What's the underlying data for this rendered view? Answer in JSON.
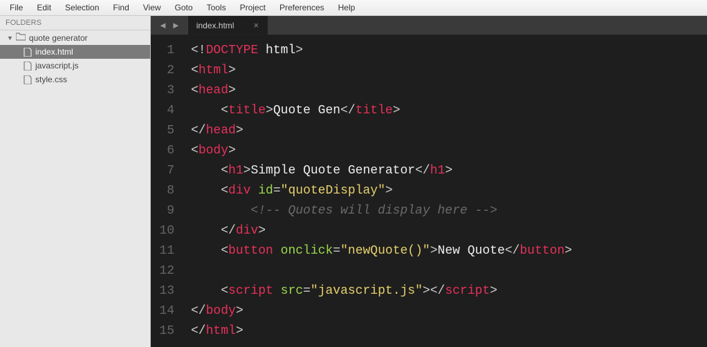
{
  "menubar": [
    "File",
    "Edit",
    "Selection",
    "Find",
    "View",
    "Goto",
    "Tools",
    "Project",
    "Preferences",
    "Help"
  ],
  "sidebar": {
    "header": "FOLDERS",
    "folder": "quote generator",
    "files": [
      {
        "name": "index.html",
        "active": true
      },
      {
        "name": "javascript.js",
        "active": false
      },
      {
        "name": "style.css",
        "active": false
      }
    ]
  },
  "tab": {
    "title": "index.html"
  },
  "code": {
    "tokens": [
      [
        {
          "t": "p",
          "v": "<!"
        },
        {
          "t": "doctype-kw",
          "v": "DOCTYPE"
        },
        {
          "t": "txt",
          "v": " html"
        },
        {
          "t": "p",
          "v": ">"
        }
      ],
      [
        {
          "t": "p",
          "v": "<"
        },
        {
          "t": "tag",
          "v": "html"
        },
        {
          "t": "p",
          "v": ">"
        }
      ],
      [
        {
          "t": "p",
          "v": "<"
        },
        {
          "t": "tag",
          "v": "head"
        },
        {
          "t": "p",
          "v": ">"
        }
      ],
      [
        {
          "t": "txt",
          "v": "    "
        },
        {
          "t": "p",
          "v": "<"
        },
        {
          "t": "tag",
          "v": "title"
        },
        {
          "t": "p",
          "v": ">"
        },
        {
          "t": "txt",
          "v": "Quote Gen"
        },
        {
          "t": "p",
          "v": "</"
        },
        {
          "t": "tag",
          "v": "title"
        },
        {
          "t": "p",
          "v": ">"
        }
      ],
      [
        {
          "t": "p",
          "v": "</"
        },
        {
          "t": "tag",
          "v": "head"
        },
        {
          "t": "p",
          "v": ">"
        }
      ],
      [
        {
          "t": "p",
          "v": "<"
        },
        {
          "t": "tag",
          "v": "body"
        },
        {
          "t": "p",
          "v": ">"
        }
      ],
      [
        {
          "t": "txt",
          "v": "    "
        },
        {
          "t": "p",
          "v": "<"
        },
        {
          "t": "tag",
          "v": "h1"
        },
        {
          "t": "p",
          "v": ">"
        },
        {
          "t": "txt",
          "v": "Simple Quote Generator"
        },
        {
          "t": "p",
          "v": "</"
        },
        {
          "t": "tag",
          "v": "h1"
        },
        {
          "t": "p",
          "v": ">"
        }
      ],
      [
        {
          "t": "txt",
          "v": "    "
        },
        {
          "t": "p",
          "v": "<"
        },
        {
          "t": "tag",
          "v": "div"
        },
        {
          "t": "txt",
          "v": " "
        },
        {
          "t": "attr",
          "v": "id"
        },
        {
          "t": "p",
          "v": "="
        },
        {
          "t": "val",
          "v": "\"quoteDisplay\""
        },
        {
          "t": "p",
          "v": ">"
        }
      ],
      [
        {
          "t": "txt",
          "v": "        "
        },
        {
          "t": "cmt",
          "v": "<!-- Quotes will display here -->"
        }
      ],
      [
        {
          "t": "txt",
          "v": "    "
        },
        {
          "t": "p",
          "v": "</"
        },
        {
          "t": "tag",
          "v": "div"
        },
        {
          "t": "p",
          "v": ">"
        }
      ],
      [
        {
          "t": "txt",
          "v": "    "
        },
        {
          "t": "p",
          "v": "<"
        },
        {
          "t": "tag",
          "v": "button"
        },
        {
          "t": "txt",
          "v": " "
        },
        {
          "t": "attr",
          "v": "onclick"
        },
        {
          "t": "p",
          "v": "="
        },
        {
          "t": "val",
          "v": "\"newQuote()\""
        },
        {
          "t": "p",
          "v": ">"
        },
        {
          "t": "txt",
          "v": "New Quote"
        },
        {
          "t": "p",
          "v": "</"
        },
        {
          "t": "tag",
          "v": "button"
        },
        {
          "t": "p",
          "v": ">"
        }
      ],
      [],
      [
        {
          "t": "txt",
          "v": "    "
        },
        {
          "t": "p",
          "v": "<"
        },
        {
          "t": "tag",
          "v": "script"
        },
        {
          "t": "txt",
          "v": " "
        },
        {
          "t": "attr",
          "v": "src"
        },
        {
          "t": "p",
          "v": "="
        },
        {
          "t": "val",
          "v": "\"javascript.js\""
        },
        {
          "t": "p",
          "v": ">"
        },
        {
          "t": "p",
          "v": "</"
        },
        {
          "t": "tag",
          "v": "script"
        },
        {
          "t": "p",
          "v": ">"
        }
      ],
      [
        {
          "t": "p",
          "v": "</"
        },
        {
          "t": "tag",
          "v": "body"
        },
        {
          "t": "p",
          "v": ">"
        }
      ],
      [
        {
          "t": "p",
          "v": "</"
        },
        {
          "t": "tag",
          "v": "html"
        },
        {
          "t": "p",
          "v": ">"
        }
      ]
    ]
  }
}
